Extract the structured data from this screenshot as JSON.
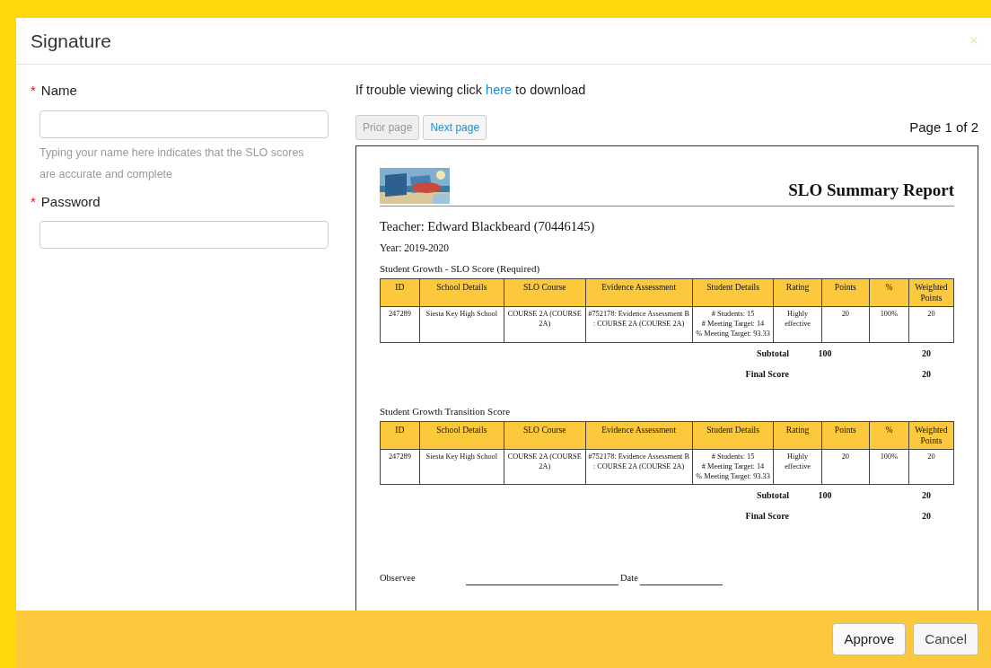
{
  "dialog": {
    "title": "Signature",
    "close": "×"
  },
  "fields": [
    {
      "required_mark": "*",
      "label": "Name",
      "help": "Typing your name here indicates that the SLO scores are accurate and complete"
    },
    {
      "required_mark": "*",
      "label": "Password"
    }
  ],
  "viewer": {
    "notice_before": "If trouble viewing click",
    "notice_link": "here",
    "notice_after": "to download",
    "buttons": [
      {
        "label": "Prior page",
        "disabled": true
      },
      {
        "label": "Next page",
        "disabled": false
      }
    ],
    "page_indicator": "Page 1 of 2",
    "report": {
      "title": "SLO Summary Report",
      "teacher": "Teacher: Edward Blackbeard (70446145)",
      "year": "Year: 2019-2020",
      "sections": [
        {
          "heading": "Student Growth - SLO Score (Required)",
          "columns": [
            "ID",
            "School Details",
            "SLO Course",
            "Evidence Assessment",
            "Student Details",
            "Rating",
            "Points",
            "%",
            "Weighted Points"
          ],
          "rows": [
            [
              "247289",
              "Siesta Key High School",
              "COURSE 2A (COURSE 2A)",
              "#752178: Evidence Assessment B : COURSE 2A (COURSE 2A)",
              "# Students: 15\n# Meeting Target: 14\n% Meeting Target: 93.33",
              "Highly effective",
              "20",
              "100%",
              "20"
            ]
          ],
          "subtotal": {
            "label": "Subtotal",
            "points": "100",
            "weighted": "20"
          },
          "final": {
            "label": "Final Score",
            "weighted": "20"
          }
        },
        {
          "heading": "Student Growth Transition Score",
          "columns": [
            "ID",
            "School Details",
            "SLO Course",
            "Evidence Assessment",
            "Student Details",
            "Rating",
            "Points",
            "%",
            "Weighted Points"
          ],
          "rows": [
            [
              "247289",
              "Siesta Key High School",
              "COURSE 2A (COURSE 2A)",
              "#752178: Evidence Assessment B : COURSE 2A (COURSE 2A)",
              "# Students: 15\n# Meeting Target: 14\n% Meeting Target: 93.33",
              "Highly effective",
              "20",
              "100%",
              "20"
            ]
          ],
          "subtotal": {
            "label": "Subtotal",
            "points": "100",
            "weighted": "20"
          },
          "final": {
            "label": "Final Score",
            "weighted": "20"
          }
        }
      ],
      "signature": {
        "observee": "Observee",
        "date": "Date"
      }
    }
  },
  "footer_buttons": [
    {
      "label": "Approve",
      "kind": "primary"
    },
    {
      "label": "Cancel",
      "kind": "secondary"
    }
  ]
}
